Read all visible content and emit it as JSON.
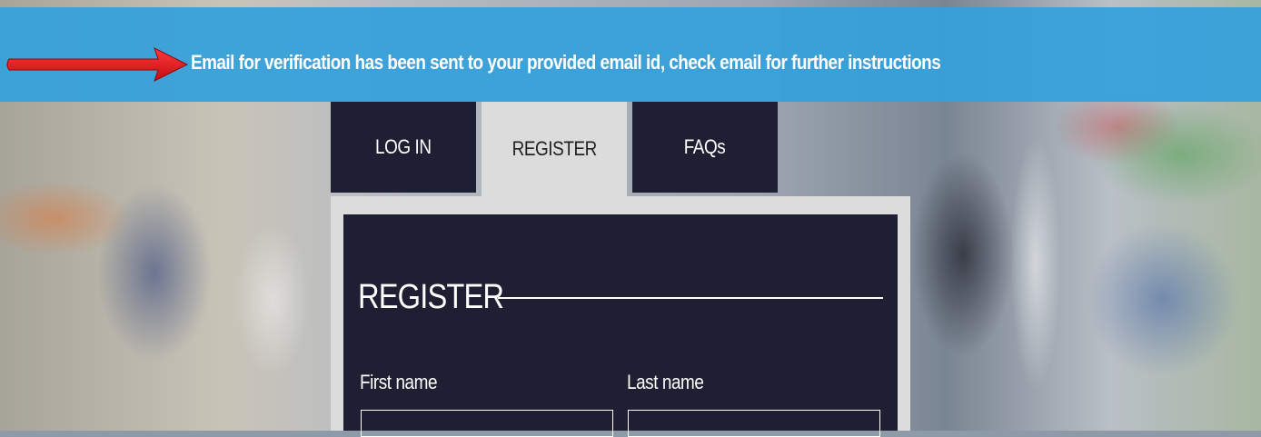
{
  "notification": {
    "message": "Email for verification has been sent to your provided email id, check email for further instructions"
  },
  "tabs": [
    {
      "label": "LOG IN",
      "active": false
    },
    {
      "label": "REGISTER",
      "active": true
    },
    {
      "label": "FAQs",
      "active": false
    }
  ],
  "form": {
    "title": "REGISTER",
    "first_name_label": "First name",
    "last_name_label": "Last name",
    "first_name_value": "",
    "last_name_value": ""
  },
  "colors": {
    "notice_bg": "#34a0dc",
    "panel_bg": "#1e1f33",
    "active_tab_bg": "#dcdcdc",
    "arrow": "#e0141a"
  }
}
